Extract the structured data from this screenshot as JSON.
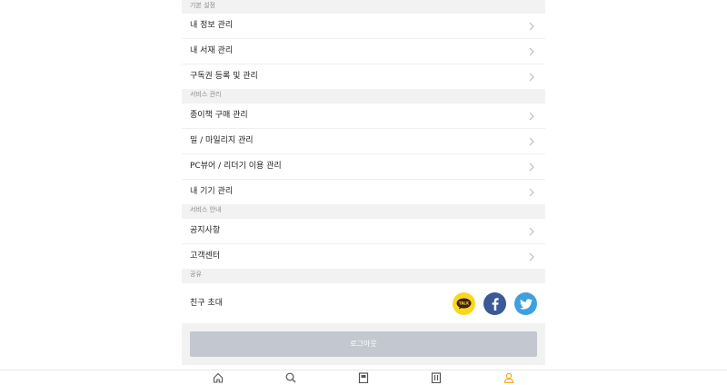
{
  "sections": {
    "basic": {
      "header": "기본 설정",
      "items": [
        "내 정보 관리",
        "내 서재 관리",
        "구독권 등록 및 관리"
      ]
    },
    "service": {
      "header": "서비스 관리",
      "items": [
        "종이책 구매 관리",
        "밀 / 마일리지 관리",
        "PC뷰어 / 리더기 이용 관리",
        "내 기기 관리"
      ]
    },
    "guide": {
      "header": "서비스 안내",
      "items": [
        "공지사항",
        "고객센터"
      ]
    },
    "share": {
      "header": "공유",
      "label": "친구 초대",
      "buttons": [
        {
          "icon": "kakaotalk-icon",
          "color": "#f9d71c",
          "text": "TALK"
        },
        {
          "icon": "facebook-icon",
          "color": "#3b5998"
        },
        {
          "icon": "twitter-icon",
          "color": "#3fa0e0"
        }
      ]
    }
  },
  "logout": {
    "label": "로그아웃"
  },
  "tabbar": {
    "items": [
      {
        "icon": "home-icon"
      },
      {
        "icon": "search-icon"
      },
      {
        "icon": "book-icon"
      },
      {
        "icon": "library-icon"
      },
      {
        "icon": "user-icon",
        "active": true
      }
    ],
    "active_color": "#f5a623",
    "inactive_color": "#555555"
  }
}
